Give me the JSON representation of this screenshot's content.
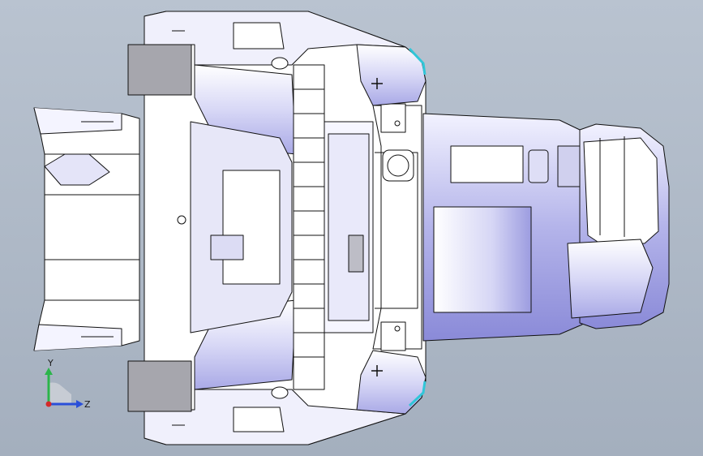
{
  "viewport": {
    "model_name": "",
    "background_top": "#b9c3d0",
    "background_bottom": "#a4afbe",
    "model_fill": "#ffffff",
    "model_shade": "#c9c9f0",
    "model_edge": "#111111",
    "highlight": "#31c6d8"
  },
  "triad": {
    "y_label": "Y",
    "z_label": "Z",
    "y_color": "#2bb54a",
    "z_color": "#2a4fd9",
    "x_color": "#d42a2a"
  }
}
